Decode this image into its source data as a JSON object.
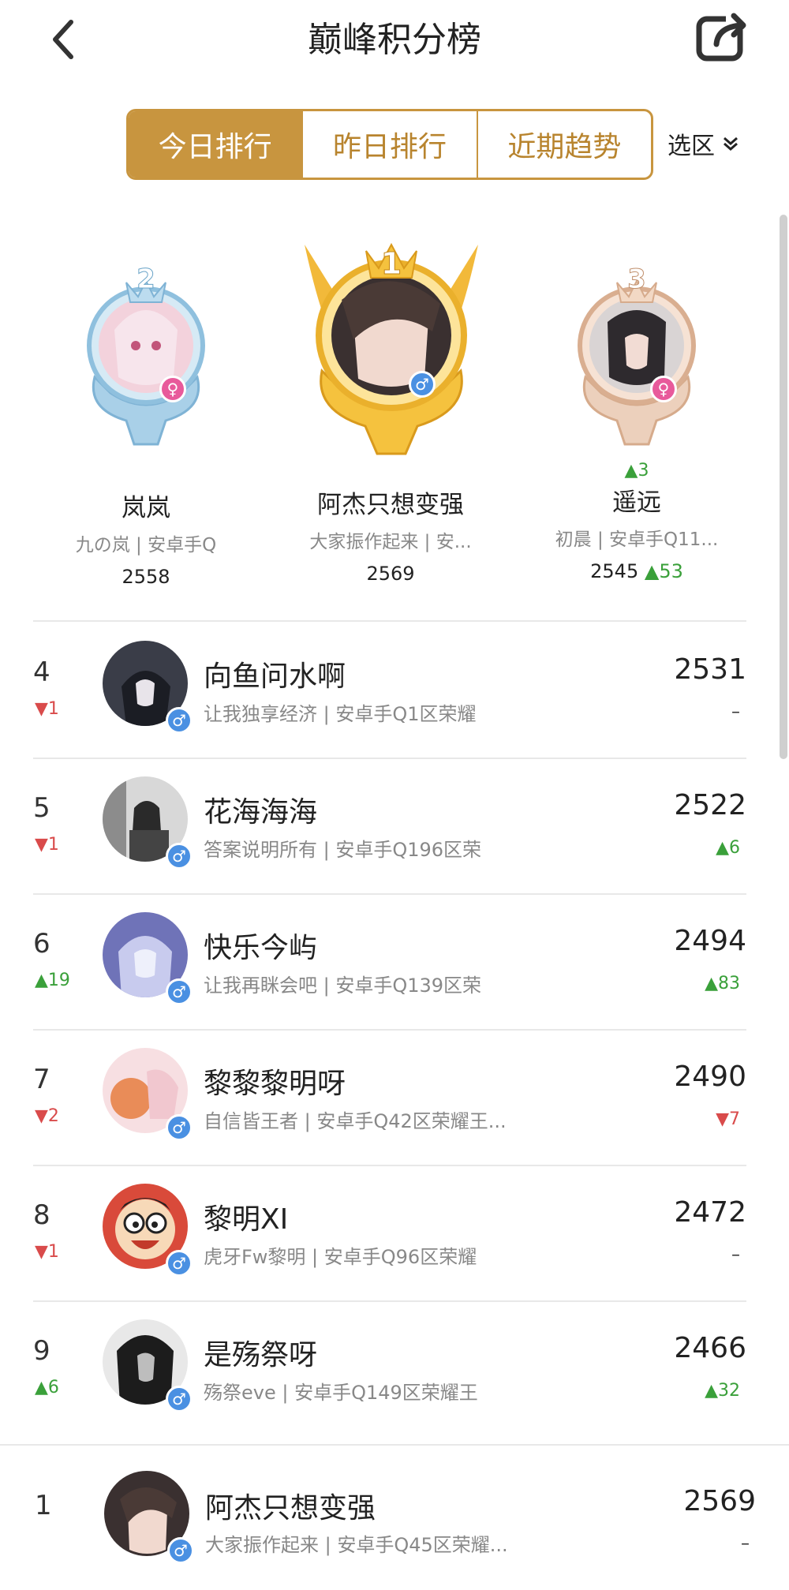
{
  "header": {
    "title": "巅峰积分榜",
    "back_icon": "chevron-left-icon",
    "share_icon": "share-icon"
  },
  "tabs": [
    {
      "label": "今日排行",
      "active": true
    },
    {
      "label": "昨日排行",
      "active": false
    },
    {
      "label": "近期趋势",
      "active": false
    }
  ],
  "region": {
    "label": "选区",
    "icon": "chevron-double-down-icon"
  },
  "podium": [
    {
      "rank": "2",
      "name": "岚岚",
      "sub": "九の岚 | 安卓手Q",
      "score": "2558",
      "change": "",
      "score_change": "",
      "gender": "female"
    },
    {
      "rank": "1",
      "name": "阿杰只想变强",
      "sub": "大家振作起来 | 安...",
      "score": "2569",
      "change": "",
      "score_change": "",
      "gender": "male"
    },
    {
      "rank": "3",
      "name": "遥远",
      "sub": "初晨 | 安卓手Q11...",
      "score": "2545",
      "change": "▲3",
      "score_change": "▲53",
      "gender": "female"
    }
  ],
  "list": [
    {
      "rank": "4",
      "rank_change": "▼1",
      "dir": "down",
      "name": "向鱼问水啊",
      "sub": "让我独享经济 | 安卓手Q1区荣耀",
      "score": "2531",
      "score_change": "–",
      "sdir": "none"
    },
    {
      "rank": "5",
      "rank_change": "▼1",
      "dir": "down",
      "name": "花海海海",
      "sub": "答案说明所有 | 安卓手Q196区荣",
      "score": "2522",
      "score_change": "▲6",
      "sdir": "up"
    },
    {
      "rank": "6",
      "rank_change": "▲19",
      "dir": "up",
      "name": "快乐今屿",
      "sub": "让我再眯会吧 | 安卓手Q139区荣",
      "score": "2494",
      "score_change": "▲83",
      "sdir": "up"
    },
    {
      "rank": "7",
      "rank_change": "▼2",
      "dir": "down",
      "name": "黎黎黎明呀",
      "sub": "自信皆王者 | 安卓手Q42区荣耀王...",
      "score": "2490",
      "score_change": "▼7",
      "sdir": "down"
    },
    {
      "rank": "8",
      "rank_change": "▼1",
      "dir": "down",
      "name": "黎明XI",
      "sub": "虎牙Fw黎明 | 安卓手Q96区荣耀",
      "score": "2472",
      "score_change": "–",
      "sdir": "none"
    },
    {
      "rank": "9",
      "rank_change": "▲6",
      "dir": "up",
      "name": "是殇祭呀",
      "sub": "殇祭eve | 安卓手Q149区荣耀王",
      "score": "2466",
      "score_change": "▲32",
      "sdir": "up"
    }
  ],
  "me": {
    "rank": "1",
    "name": "阿杰只想变强",
    "sub": "大家振作起来 | 安卓手Q45区荣耀...",
    "score": "2569",
    "score_change": "–"
  },
  "colors": {
    "gold": "#c8953f",
    "up": "#3aa03a",
    "down": "#d94b4b",
    "male": "#4a90e2",
    "female": "#e85a9b"
  }
}
